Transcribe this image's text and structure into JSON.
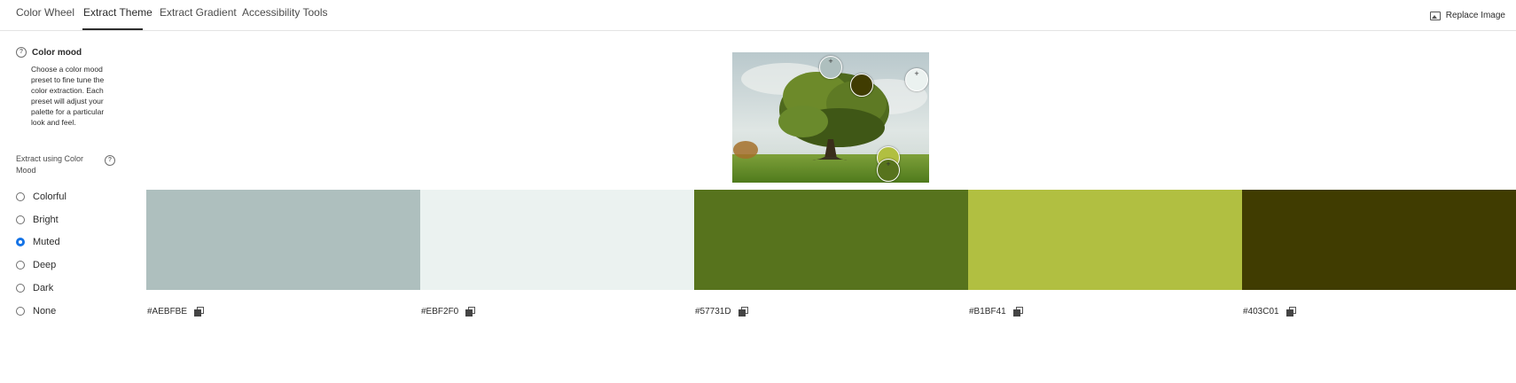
{
  "tabs": [
    {
      "label": "Color Wheel",
      "active": false
    },
    {
      "label": "Extract Theme",
      "active": true
    },
    {
      "label": "Extract Gradient",
      "active": false
    },
    {
      "label": "Accessibility Tools",
      "active": false
    }
  ],
  "replace_image": {
    "label": "Replace Image",
    "icon": "image-icon"
  },
  "left_panel": {
    "mood_title": "Color mood",
    "mood_description": "Choose a color mood preset to fine tune the color extraction. Each preset will adjust your palette for a particular look and feel.",
    "extract_label": "Extract using Color Mood",
    "options": [
      {
        "label": "Colorful",
        "checked": false
      },
      {
        "label": "Bright",
        "checked": false
      },
      {
        "label": "Muted",
        "checked": true
      },
      {
        "label": "Deep",
        "checked": false
      },
      {
        "label": "Dark",
        "checked": false
      },
      {
        "label": "None",
        "checked": false
      }
    ]
  },
  "swatches": [
    {
      "hex": "#AEBFBE",
      "color": "#AEBFBE"
    },
    {
      "hex": "#EBF2F0",
      "color": "#EBF2F0"
    },
    {
      "hex": "#57731D",
      "color": "#57731D"
    },
    {
      "hex": "#B1BF41",
      "color": "#B1BF41"
    },
    {
      "hex": "#403C01",
      "color": "#403C01"
    }
  ],
  "accent_color": "#1473E6"
}
